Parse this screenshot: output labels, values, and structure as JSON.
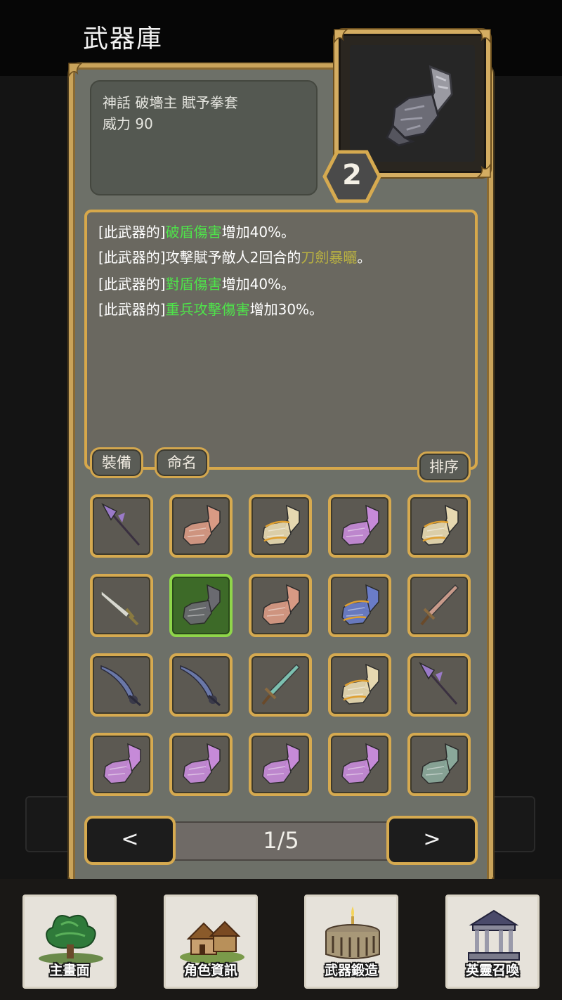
{
  "header": {
    "title": "武器庫"
  },
  "weapon": {
    "name": "神話  破墻主 賦予拳套",
    "power": "威力 90",
    "level": "2",
    "preview_icon": "gauntlet-icon"
  },
  "effects": [
    {
      "p1": "[此武器的]",
      "h1": "破盾傷害",
      "p2": "增加40%。",
      "color": "green"
    },
    {
      "p1": "[此武器的]攻擊賦予敵人2回合的",
      "h1": "刀劍暴曬",
      "p2": "。",
      "color": "olive"
    },
    {
      "p1": "[此武器的]",
      "h1": "對盾傷害",
      "p2": "增加40%。",
      "color": "green"
    },
    {
      "p1": "[此武器的]",
      "h1": "重兵攻擊傷害",
      "p2": "增加30%。",
      "color": "green"
    }
  ],
  "actions": {
    "equip": "裝備",
    "rename": "命名",
    "sort": "排序"
  },
  "inventory": [
    {
      "icon": "spear-icon",
      "tint": "#9a7ac8"
    },
    {
      "icon": "gauntlet-icon",
      "tint": "#d89a84"
    },
    {
      "icon": "ornate-gauntlet-icon",
      "tint": "#e6d8b0"
    },
    {
      "icon": "gauntlet-icon",
      "tint": "#c68ad8"
    },
    {
      "icon": "ornate-gauntlet-icon",
      "tint": "#e6d8b0"
    },
    {
      "icon": "dagger-icon",
      "tint": "#d8d8d0"
    },
    {
      "icon": "gauntlet-icon",
      "tint": "#6a6a70",
      "selected": true
    },
    {
      "icon": "gauntlet-icon",
      "tint": "#d89a84"
    },
    {
      "icon": "ornate-gauntlet-icon",
      "tint": "#6a7cc8"
    },
    {
      "icon": "sword-icon",
      "tint": "#c89a8a"
    },
    {
      "icon": "curved-sword-icon",
      "tint": "#6a78a8"
    },
    {
      "icon": "curved-sword-icon",
      "tint": "#6a78a8"
    },
    {
      "icon": "sword-icon",
      "tint": "#7cc0b0"
    },
    {
      "icon": "ornate-gauntlet-icon",
      "tint": "#e6d8b0"
    },
    {
      "icon": "spear-icon",
      "tint": "#9a7ac8"
    },
    {
      "icon": "gauntlet-icon",
      "tint": "#c68ad8"
    },
    {
      "icon": "gauntlet-icon",
      "tint": "#c68ad8"
    },
    {
      "icon": "gauntlet-icon",
      "tint": "#c68ad8"
    },
    {
      "icon": "gauntlet-icon",
      "tint": "#c68ad8"
    },
    {
      "icon": "gauntlet-icon",
      "tint": "#8aa89a"
    }
  ],
  "pager": {
    "prev": "<",
    "page": "1/5",
    "next": ">"
  },
  "nav": [
    {
      "label": "主畫面",
      "icon": "forest-icon"
    },
    {
      "label": "角色資訊",
      "icon": "village-icon"
    },
    {
      "label": "武器鍛造",
      "icon": "colosseum-icon"
    },
    {
      "label": "英靈召喚",
      "icon": "temple-icon"
    }
  ],
  "colors": {
    "frame_gold": "#d6aa50",
    "selected_green": "#8fd64a",
    "highlight_green": "#4ee44a",
    "highlight_olive": "#b8b042"
  }
}
